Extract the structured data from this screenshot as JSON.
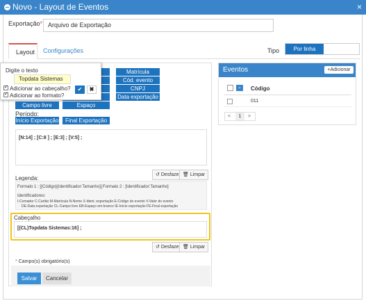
{
  "window": {
    "title": "Novo - Layout de Eventos",
    "close": "×"
  },
  "form": {
    "exportacao_label": "Exportação",
    "required_mark": "*",
    "exportacao_value": "Arquivo de Exportação"
  },
  "tabs": {
    "layout": "Layout",
    "configuracoes": "Configurações"
  },
  "tipo": {
    "label": "Tipo",
    "por_linha": "Por linha",
    "other": ""
  },
  "field_buttons": {
    "row1": [
      "",
      "Matrícula"
    ],
    "row2": [
      "",
      "Cód. evento"
    ],
    "row3": [
      "",
      "CNPJ"
    ],
    "row4": [
      "",
      "Data exportação"
    ],
    "row5": [
      "Campo livre",
      "Espaço"
    ]
  },
  "periodo": {
    "label": "Período:",
    "inicio": "Início Exportação",
    "final": "Final Exportação"
  },
  "format_text": "[N:14] ; [C:8 ] ; [E:3] ; [V:5] ;",
  "actions": {
    "desfazer": "Desfazer",
    "limpar": "Limpar"
  },
  "legenda": {
    "title": "Legenda:",
    "formato1": "Formato 1 : [{Código}{Identificador:Tamanho}]",
    "formato2": "Formato 2 : [Identificador:Tamanho]",
    "identificadores": "Identificadores:",
    "line1": "I-Comador   C-Cartão   M-Matrícula   N-Nome   X-Ident. exportação   E-Código do evento   V-Valor do evento",
    "line2": "DE-Data exportação   CL-Campo livre   EB-Espaço em branco   IE-Início exportação   FE-Final exportação"
  },
  "cabecalho": {
    "label": "Cabeçalho",
    "value": "[(CL)Topdata Sistemas:16] ;"
  },
  "footer": {
    "required_note": "Campo(s) obrigatório(s)",
    "salvar": "Salvar",
    "cancelar": "Cancelar"
  },
  "eventos": {
    "title": "Eventos",
    "add": "Adicionar",
    "col_codigo": "Código",
    "rows": [
      "011"
    ],
    "pagination": {
      "prev": "<",
      "page": "1",
      "next": ">"
    }
  },
  "popup": {
    "title": "Digite o texto",
    "input_value": "Topdata Sistemas",
    "opt_cabecalho": "Adicionar ao cabeçalho?",
    "opt_formato": "Adicionar ao formato?"
  },
  "colors": {
    "primary": "#1e73be",
    "title_bar": "#3a85c9",
    "highlight": "#f0c419"
  }
}
